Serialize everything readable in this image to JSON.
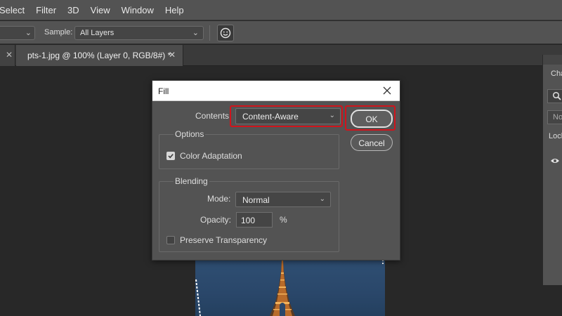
{
  "menu": [
    "Select",
    "Filter",
    "3D",
    "View",
    "Window",
    "Help"
  ],
  "options_bar": {
    "sample_label": "Sample:",
    "sample_value": "All Layers"
  },
  "tabs": {
    "active_title": "pts-1.jpg @ 100% (Layer 0, RGB/8#) *"
  },
  "right_panel": {
    "header_partial": "Cha",
    "blend_partial": "No",
    "lock_partial": "Lock"
  },
  "dialog": {
    "title": "Fill",
    "contents_label": "Contents:",
    "contents_value": "Content-Aware",
    "options_title": "Options",
    "color_adaptation_label": "Color Adaptation",
    "color_adaptation_checked": true,
    "blending_title": "Blending",
    "mode_label": "Mode:",
    "mode_value": "Normal",
    "opacity_label": "Opacity:",
    "opacity_value": "100",
    "opacity_unit": "%",
    "preserve_label": "Preserve Transparency",
    "preserve_checked": false,
    "ok_label": "OK",
    "cancel_label": "Cancel"
  },
  "colors": {
    "highlight": "#d0141c",
    "dialog_bg": "#535353",
    "app_bg": "#282828"
  }
}
